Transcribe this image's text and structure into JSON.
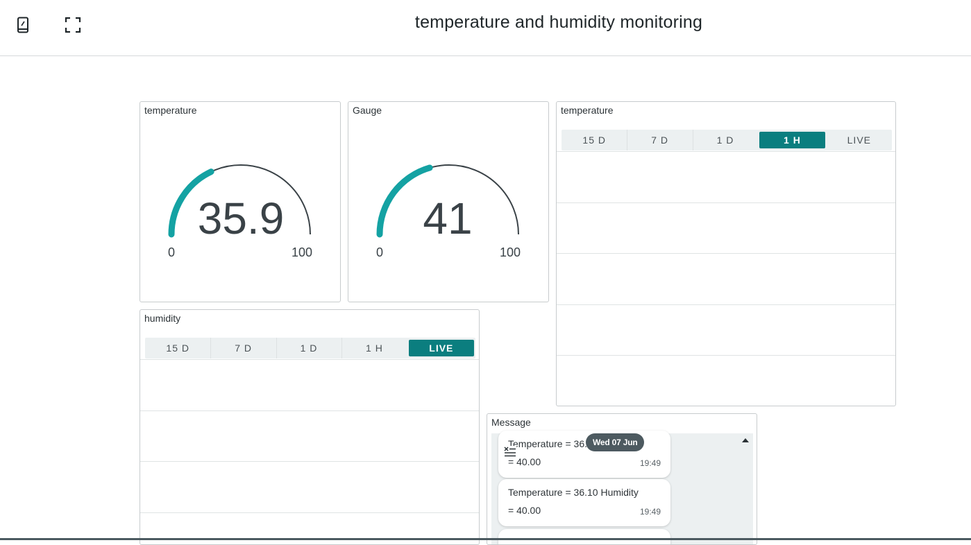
{
  "header": {
    "title": "temperature and humidity monitoring",
    "icons": [
      "mobile-view-icon",
      "fullscreen-icon"
    ]
  },
  "widgets": {
    "temp_gauge": {
      "title": "temperature",
      "value": "35.9",
      "min": "0",
      "max": "100",
      "fill_fraction": 0.359
    },
    "gauge": {
      "title": "Gauge",
      "value": "41",
      "min": "0",
      "max": "100",
      "fill_fraction": 0.41
    },
    "temp_chart": {
      "title": "temperature",
      "ranges": [
        "15 D",
        "7 D",
        "1 D",
        "1 H",
        "LIVE"
      ],
      "active": "1 H"
    },
    "humidity_chart": {
      "title": "humidity",
      "ranges": [
        "15 D",
        "7 D",
        "1 D",
        "1 H",
        "LIVE"
      ],
      "active": "LIVE"
    },
    "messenger": {
      "title": "Message",
      "date_label": "Wed 07 Jun",
      "messages": [
        {
          "line1": "Temperature = 36.10 Humidity",
          "line2": "= 40.00",
          "time": "19:49"
        },
        {
          "line1": "Temperature = 36.10 Humidity",
          "line2": "= 40.00",
          "time": "19:49"
        }
      ]
    }
  },
  "colors": {
    "accent": "#0b7e7f",
    "gauge_fill": "#14a2a3",
    "gauge_track": "#3a4247"
  }
}
